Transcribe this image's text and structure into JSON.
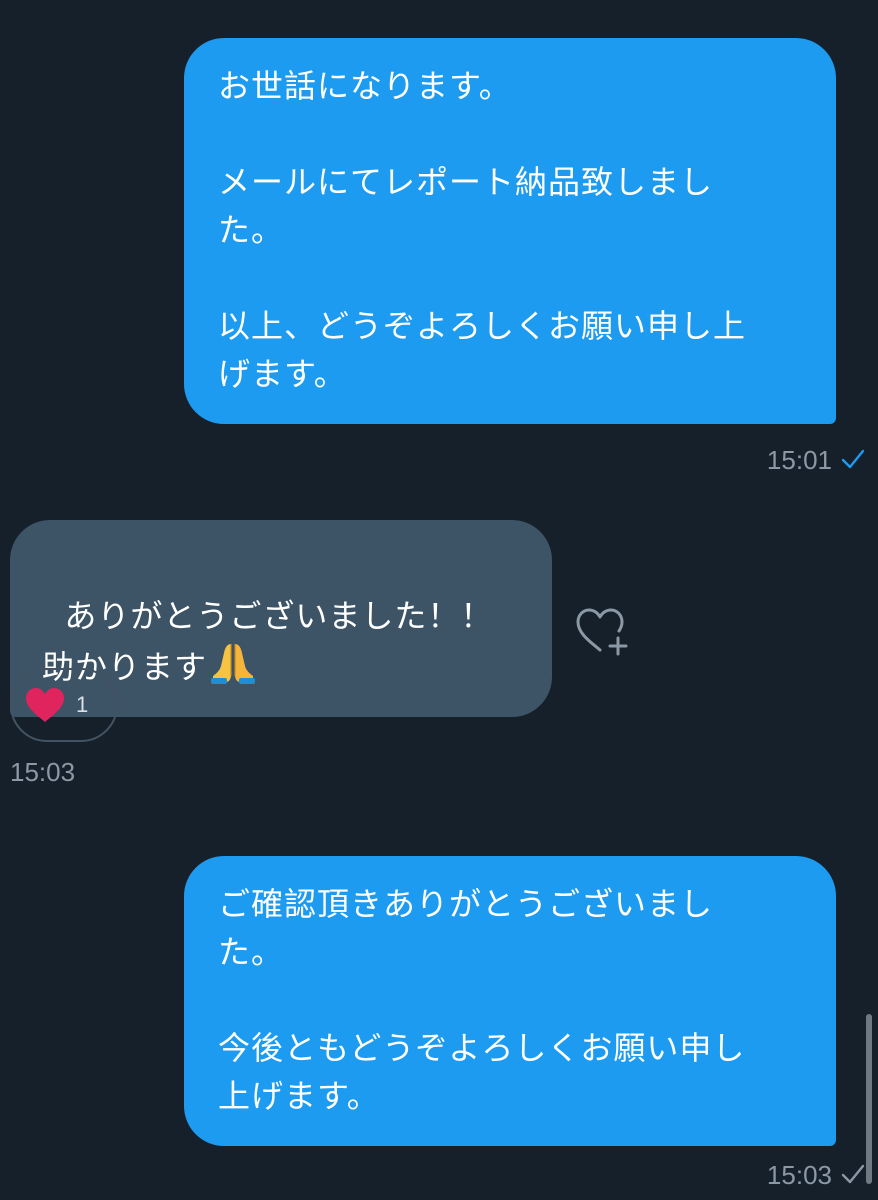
{
  "messages": [
    {
      "direction": "sent",
      "text": "お世話になります。\n\nメールにてレポート納品致しまし\nた。\n\n以上、どうぞよろしくお願い申し上\nげます。",
      "time": "15:01",
      "status": "read"
    },
    {
      "direction": "received",
      "text": "ありがとうございました！！\n助かります",
      "emoji": "folded-hands",
      "reaction": {
        "emoji": "heart",
        "count": "1"
      },
      "time": "15:03"
    },
    {
      "direction": "sent",
      "text": "ご確認頂きありがとうございまし\nた。\n\n今後ともどうぞよろしくお願い申し\n上げます。",
      "time": "15:03",
      "status": "sent"
    }
  ],
  "icons": {
    "read_check": "check-icon",
    "add_reaction": "heart-plus-icon",
    "reaction": "heart-icon",
    "emoji": "folded-hands-icon"
  },
  "colors": {
    "background": "#15202b",
    "sent_bubble": "#1d9bf0",
    "received_bubble": "#3d5466",
    "read_check": "#1d9bf0",
    "reaction_heart": "#e0245e",
    "meta_text": "#8b98a5"
  }
}
